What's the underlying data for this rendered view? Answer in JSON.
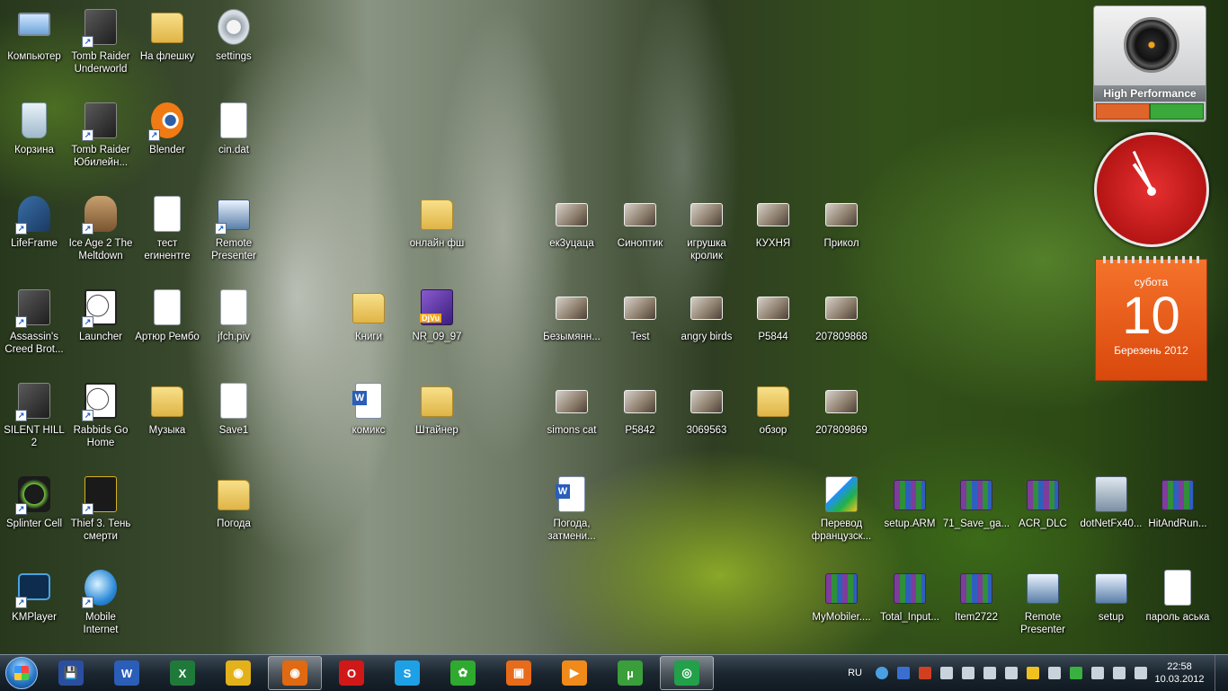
{
  "desktop": {
    "icons": [
      {
        "id": "computer",
        "label": "Компьютер",
        "type": "pc",
        "shortcut": false
      },
      {
        "id": "tomb-raider-underworld",
        "label": "Tomb Raider Underworld",
        "type": "game",
        "shortcut": true
      },
      {
        "id": "na-fleshku",
        "label": "На флешку",
        "type": "folder",
        "shortcut": false
      },
      {
        "id": "settings",
        "label": "settings",
        "type": "gear",
        "shortcut": false
      },
      {
        "id": "korzina",
        "label": "Корзина",
        "type": "bin",
        "shortcut": false
      },
      {
        "id": "tomb-raider-jubilee",
        "label": "Tomb Raider Юбилейн...",
        "type": "game",
        "shortcut": true
      },
      {
        "id": "blender",
        "label": "Blender",
        "type": "blender",
        "shortcut": true
      },
      {
        "id": "cin-dat",
        "label": "cin.dat",
        "type": "doc",
        "shortcut": false
      },
      {
        "id": "lifeframe",
        "label": "LifeFrame",
        "type": "life",
        "shortcut": true
      },
      {
        "id": "ice-age-2",
        "label": "Ice Age 2 The Meltdown",
        "type": "ice",
        "shortcut": true
      },
      {
        "id": "test-erinentre",
        "label": "тест erинентre",
        "type": "doc",
        "shortcut": false
      },
      {
        "id": "remote-presenter-1",
        "label": "Remote Presenter",
        "type": "present",
        "shortcut": true
      },
      {
        "id": "onlajn-fsh",
        "label": "онлайн фш",
        "type": "folder",
        "shortcut": false
      },
      {
        "id": "ek3ucaca",
        "label": "ек3уцаца",
        "type": "photo",
        "shortcut": false
      },
      {
        "id": "sinoptik",
        "label": "Синоптик",
        "type": "photo",
        "shortcut": false
      },
      {
        "id": "igrushka-krolik",
        "label": "игрушка кролик",
        "type": "photo",
        "shortcut": false
      },
      {
        "id": "kuhnya",
        "label": "КУХНЯ",
        "type": "photo",
        "shortcut": false
      },
      {
        "id": "prikol",
        "label": "Прикол",
        "type": "photo",
        "shortcut": false
      },
      {
        "id": "assassins-creed",
        "label": "Assassin's Creed Brot...",
        "type": "game",
        "shortcut": true
      },
      {
        "id": "launcher",
        "label": "Launcher",
        "type": "rabbid",
        "shortcut": true
      },
      {
        "id": "artur-rembo",
        "label": "Артюр Рембо",
        "type": "doc",
        "shortcut": false
      },
      {
        "id": "jfch-piv",
        "label": "jfch.piv",
        "type": "doc",
        "shortcut": false
      },
      {
        "id": "knigi",
        "label": "Книги",
        "type": "folder",
        "shortcut": false
      },
      {
        "id": "nr-09-97",
        "label": "NR_09_97",
        "type": "djvu",
        "shortcut": false
      },
      {
        "id": "bezymyann",
        "label": "Безымянн...",
        "type": "photo",
        "shortcut": false
      },
      {
        "id": "test",
        "label": "Test",
        "type": "photo",
        "shortcut": false
      },
      {
        "id": "angry-birds",
        "label": "angry birds",
        "type": "photo",
        "shortcut": false
      },
      {
        "id": "p5844",
        "label": "P5844",
        "type": "photo",
        "shortcut": false
      },
      {
        "id": "img-207809868",
        "label": "207809868",
        "type": "photo",
        "shortcut": false
      },
      {
        "id": "silent-hill-2",
        "label": "SILENT HILL 2",
        "type": "game",
        "shortcut": true
      },
      {
        "id": "rabbids-go-home",
        "label": "Rabbids Go Home",
        "type": "rabbid",
        "shortcut": true
      },
      {
        "id": "muzyka",
        "label": "Музыка",
        "type": "folder",
        "shortcut": false
      },
      {
        "id": "save1",
        "label": "Save1",
        "type": "doc",
        "shortcut": false
      },
      {
        "id": "komiks",
        "label": "комикс",
        "type": "word",
        "shortcut": false
      },
      {
        "id": "shtajner",
        "label": "Штайнер",
        "type": "folder",
        "shortcut": false
      },
      {
        "id": "simons-cat",
        "label": "simons cat",
        "type": "photo",
        "shortcut": false
      },
      {
        "id": "p5842",
        "label": "P5842",
        "type": "photo",
        "shortcut": false
      },
      {
        "id": "img-3069563",
        "label": "3069563",
        "type": "photo",
        "shortcut": false
      },
      {
        "id": "obzor",
        "label": "обзор",
        "type": "folder",
        "shortcut": false
      },
      {
        "id": "img-207809869",
        "label": "207809869",
        "type": "photo",
        "shortcut": false
      },
      {
        "id": "splinter-cell",
        "label": "Splinter Cell",
        "type": "splinter",
        "shortcut": true
      },
      {
        "id": "thief-3",
        "label": "Thief 3. Тень смерти",
        "type": "thief",
        "shortcut": true
      },
      {
        "id": "pogoda",
        "label": "Погода",
        "type": "folder",
        "shortcut": false
      },
      {
        "id": "pogoda-zatmeni",
        "label": "Погода, затмени...",
        "type": "word",
        "shortcut": false
      },
      {
        "id": "perevod",
        "label": "Перевод французск...",
        "type": "translate",
        "shortcut": false
      },
      {
        "id": "setup-arm",
        "label": "setup.ARM",
        "type": "winrar",
        "shortcut": false
      },
      {
        "id": "save-ga",
        "label": "71_Save_ga...",
        "type": "winrar",
        "shortcut": false
      },
      {
        "id": "acr-dlc",
        "label": "ACR_DLC",
        "type": "winrar",
        "shortcut": false
      },
      {
        "id": "dotnetfx40",
        "label": "dotNetFx40...",
        "type": "setup",
        "shortcut": false
      },
      {
        "id": "hitandrun",
        "label": "HitAndRun...",
        "type": "winrar",
        "shortcut": false
      },
      {
        "id": "kmplayer",
        "label": "KMPlayer",
        "type": "kmp",
        "shortcut": true
      },
      {
        "id": "mobile-internet",
        "label": "Mobile Internet",
        "type": "globe",
        "shortcut": true
      },
      {
        "id": "mymobiler",
        "label": "MyMobiler....",
        "type": "winrar",
        "shortcut": false
      },
      {
        "id": "total-input",
        "label": "Total_Input...",
        "type": "winrar",
        "shortcut": false
      },
      {
        "id": "item2722",
        "label": "Item2722",
        "type": "winrar",
        "shortcut": false
      },
      {
        "id": "remote-presenter-2",
        "label": "Remote Presenter",
        "type": "present",
        "shortcut": false
      },
      {
        "id": "setup",
        "label": "setup",
        "type": "present",
        "shortcut": false
      },
      {
        "id": "parol-aska",
        "label": "пароль аська",
        "type": "doc",
        "shortcut": false
      }
    ]
  },
  "gadgets": {
    "meter": {
      "caption": "High Performance"
    },
    "calendar": {
      "weekday": "субота",
      "day": "10",
      "month_year": "Березень 2012"
    }
  },
  "taskbar": {
    "apps": [
      {
        "id": "save",
        "icon": "floppy-icon",
        "color": "#2a4fa0",
        "glyph": "💾"
      },
      {
        "id": "word",
        "icon": "word-icon",
        "color": "#2a5eb8",
        "glyph": "W"
      },
      {
        "id": "excel",
        "icon": "excel-icon",
        "color": "#1f7a3a",
        "glyph": "X"
      },
      {
        "id": "chrome",
        "icon": "chrome-icon",
        "color": "#e3b21a",
        "glyph": "◉"
      },
      {
        "id": "firefox",
        "icon": "firefox-icon",
        "color": "#e06a12",
        "glyph": "◉",
        "active": true
      },
      {
        "id": "opera",
        "icon": "opera-icon",
        "color": "#d01818",
        "glyph": "O"
      },
      {
        "id": "skype",
        "icon": "skype-icon",
        "color": "#1ea0e6",
        "glyph": "S"
      },
      {
        "id": "icq",
        "icon": "icq-icon",
        "color": "#2eaa2e",
        "glyph": "✿"
      },
      {
        "id": "acdsee",
        "icon": "photo-viewer-icon",
        "color": "#e76b1a",
        "glyph": "▣"
      },
      {
        "id": "media",
        "icon": "media-player-icon",
        "color": "#f08a1a",
        "glyph": "▶"
      },
      {
        "id": "utorrent",
        "icon": "utorrent-icon",
        "color": "#3a9e3a",
        "glyph": "µ"
      },
      {
        "id": "green",
        "icon": "power-icon",
        "color": "#22a04a",
        "glyph": "◎",
        "active": true
      }
    ],
    "tray": {
      "language": "RU",
      "time": "22:58",
      "date": "10.03.2012"
    }
  }
}
